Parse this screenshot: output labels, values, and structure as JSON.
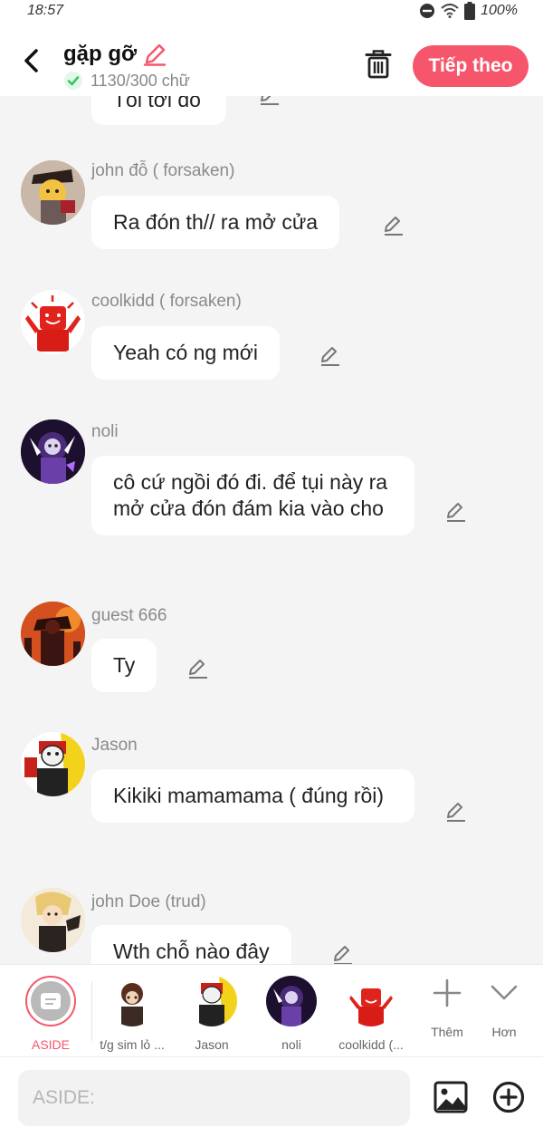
{
  "status_bar": {
    "time": "18:57",
    "battery": "100%"
  },
  "header": {
    "title": "gặp gỡ",
    "word_count": "1130/300 chữ",
    "next_label": "Tiếp theo"
  },
  "chat": {
    "partial_top_text": "Tôi tới đó",
    "messages": [
      {
        "name": "john đỗ ( forsaken)",
        "text": "Ra đón th// ra mở cửa"
      },
      {
        "name": "coolkidd ( forsaken)",
        "text": "Yeah có ng mới"
      },
      {
        "name": "noli",
        "text": "cô cứ ngồi đó đi. để tụi này ra mở cửa đón đám kia vào cho"
      },
      {
        "name": "guest 666",
        "text": "Ty"
      },
      {
        "name": "Jason",
        "text": "Kikiki mamamama ( đúng rồi)"
      },
      {
        "name": "john Doe (trud)",
        "text": "Wth chỗ nào đây"
      }
    ]
  },
  "character_bar": {
    "items": [
      {
        "label": "ASIDE",
        "icon": "aside-icon"
      },
      {
        "label": "t/g sim lỏ ..."
      },
      {
        "label": "Jason"
      },
      {
        "label": "noli"
      },
      {
        "label": "coolkidd (..."
      },
      {
        "label": "Thêm",
        "icon": "plus-icon"
      },
      {
        "label": "Hơn",
        "icon": "chevron-down-icon"
      }
    ]
  },
  "input": {
    "placeholder": "ASIDE:"
  },
  "colors": {
    "accent": "#f6566b",
    "check": "#3cc46b",
    "bubble": "#ffffff",
    "background": "#f4f4f4"
  }
}
